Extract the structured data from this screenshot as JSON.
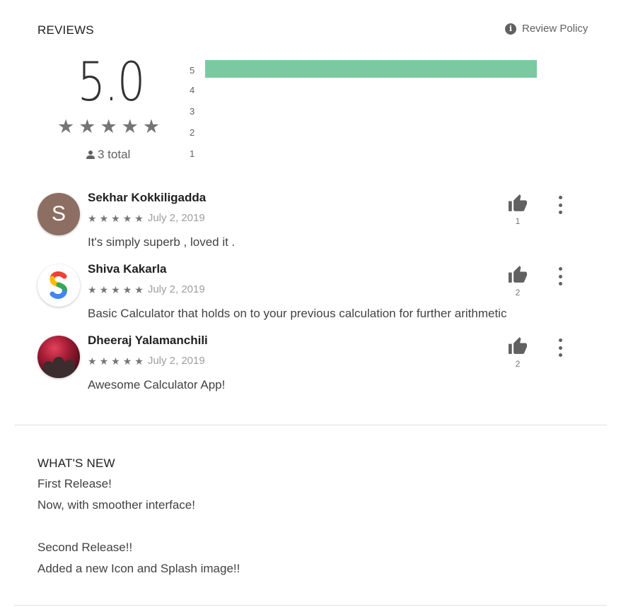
{
  "reviews_section": {
    "title": "REVIEWS",
    "policy_link": "Review Policy",
    "policy_icon": "info-icon",
    "score": "5.0",
    "total": "3 total",
    "histogram": [
      {
        "label": "5",
        "fraction": 1.0
      },
      {
        "label": "4",
        "fraction": 0
      },
      {
        "label": "3",
        "fraction": 0
      },
      {
        "label": "2",
        "fraction": 0
      },
      {
        "label": "1",
        "fraction": 0
      }
    ],
    "histogram_color": "#7bc9a1",
    "rating_stars": 5
  },
  "reviews": [
    {
      "name": "Sekhar Kokkiligadda",
      "date": "July 2, 2019",
      "stars": 5,
      "text": "It's simply superb , loved it .",
      "likes": "1",
      "avatar": "S"
    },
    {
      "name": "Shiva Kakarla",
      "date": "July 2, 2019",
      "stars": 5,
      "text": "Basic Calculator that holds on to your previous calculation for further arithmetic",
      "likes": "2",
      "avatar": "google-logo"
    },
    {
      "name": "Dheeraj Yalamanchili",
      "date": "July 2, 2019",
      "stars": 5,
      "text": "Awesome Calculator App!",
      "likes": "2",
      "avatar": "photo"
    }
  ],
  "whats_new": {
    "title": "WHAT'S NEW",
    "lines": [
      "First Release!",
      "Now, with smoother interface!",
      "",
      "Second Release!!",
      "Added a new Icon and Splash image!!"
    ]
  }
}
